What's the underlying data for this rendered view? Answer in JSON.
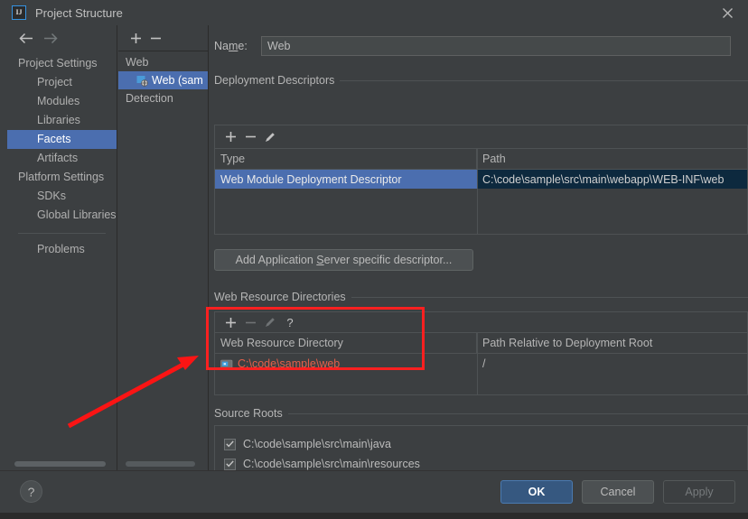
{
  "window": {
    "title": "Project Structure",
    "app_icon": "intellij-idea-icon",
    "close_icon": "close-icon"
  },
  "nav": {
    "back_icon": "arrow-left-icon",
    "forward_icon": "arrow-right-icon",
    "items": [
      {
        "label": "Project Settings",
        "type": "group",
        "selected": false
      },
      {
        "label": "Project",
        "type": "item",
        "selected": false
      },
      {
        "label": "Modules",
        "type": "item",
        "selected": false
      },
      {
        "label": "Libraries",
        "type": "item",
        "selected": false
      },
      {
        "label": "Facets",
        "type": "item",
        "selected": true
      },
      {
        "label": "Artifacts",
        "type": "item",
        "selected": false
      },
      {
        "label": "Platform Settings",
        "type": "group",
        "selected": false
      },
      {
        "label": "SDKs",
        "type": "item",
        "selected": false
      },
      {
        "label": "Global Libraries",
        "type": "item",
        "selected": false
      }
    ],
    "after_separator": [
      {
        "label": "Problems",
        "type": "item",
        "selected": false
      }
    ]
  },
  "facet_tree": {
    "add_icon": "plus-icon",
    "remove_icon": "minus-icon",
    "rows": [
      {
        "label": "Web",
        "child": false,
        "selected": false,
        "icon": null
      },
      {
        "label": "Web (sam",
        "child": true,
        "selected": true,
        "icon": "web-facet-icon"
      },
      {
        "label": "Detection",
        "child": false,
        "selected": false,
        "icon": null
      }
    ]
  },
  "form": {
    "name_label_before": "Na",
    "name_label_mnemonic": "m",
    "name_label_after": "e:",
    "name_value": "Web"
  },
  "deployment_descriptors": {
    "section_title": "Deployment Descriptors",
    "toolbar": {
      "add_icon": "plus-icon",
      "remove_icon": "minus-icon",
      "edit_icon": "pencil-icon"
    },
    "columns": [
      "Type",
      "Path"
    ],
    "rows": [
      {
        "type": "Web Module Deployment Descriptor",
        "path": "C:\\code\\sample\\src\\main\\webapp\\WEB-INF\\web",
        "selected": true
      }
    ]
  },
  "add_descriptor_button": {
    "text_before": "Add Application ",
    "mnemonic": "S",
    "text_after": "erver specific descriptor..."
  },
  "web_resource_directories": {
    "section_title": "Web Resource Directories",
    "toolbar": {
      "add_icon": "plus-icon",
      "remove_icon": "minus-icon",
      "edit_icon": "pencil-icon",
      "help_icon": "question-icon"
    },
    "columns": [
      "Web Resource Directory",
      "Path Relative to Deployment Root"
    ],
    "rows": [
      {
        "directory": "C:\\code\\sample\\web",
        "directory_icon": "folder-icon",
        "relative_path": "/"
      }
    ]
  },
  "source_roots": {
    "section_title": "Source Roots",
    "items": [
      {
        "label": "C:\\code\\sample\\src\\main\\java",
        "checked": true
      },
      {
        "label": "C:\\code\\sample\\src\\main\\resources",
        "checked": true
      }
    ]
  },
  "footer": {
    "help_label": "?",
    "ok_label": "OK",
    "cancel_label": "Cancel",
    "apply_label": "Apply"
  },
  "annotation": {
    "highlight_color": "#fb2020",
    "arrow_color": "#fb1414"
  }
}
